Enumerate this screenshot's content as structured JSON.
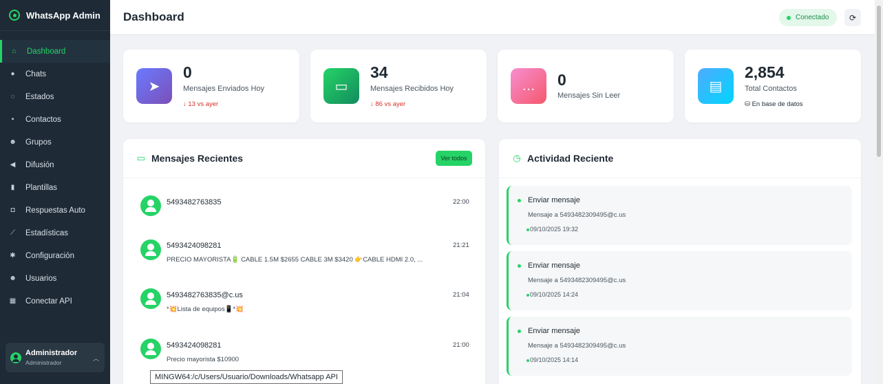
{
  "app": {
    "title": "WhatsApp Admin"
  },
  "sidebar": {
    "items": [
      {
        "label": "Dashboard",
        "icon": "home-icon",
        "glyph": "⌂"
      },
      {
        "label": "Chats",
        "icon": "comments-icon",
        "glyph": "●"
      },
      {
        "label": "Estados",
        "icon": "circle-notch-icon",
        "glyph": "◌"
      },
      {
        "label": "Contactos",
        "icon": "address-book-icon",
        "glyph": "▪"
      },
      {
        "label": "Grupos",
        "icon": "users-icon",
        "glyph": "☻"
      },
      {
        "label": "Difusión",
        "icon": "bullhorn-icon",
        "glyph": "◀"
      },
      {
        "label": "Plantillas",
        "icon": "file-icon",
        "glyph": "▮"
      },
      {
        "label": "Respuestas Auto",
        "icon": "robot-icon",
        "glyph": "◘"
      },
      {
        "label": "Estadísticas",
        "icon": "chart-line-icon",
        "glyph": "⟋"
      },
      {
        "label": "Configuración",
        "icon": "gear-icon",
        "glyph": "✱"
      },
      {
        "label": "Usuarios",
        "icon": "user-group-icon",
        "glyph": "☻"
      },
      {
        "label": "Conectar API",
        "icon": "qrcode-icon",
        "glyph": "▦"
      }
    ],
    "user": {
      "name": "Administrador",
      "role": "Administrador"
    }
  },
  "header": {
    "title": "Dashboard",
    "status": "Conectado",
    "refresh_icon": "sync-icon"
  },
  "stats": [
    {
      "value": "0",
      "label": "Mensajes Enviados Hoy",
      "sub": "↓ 13 vs ayer",
      "icon": "paper-plane-icon",
      "glyph": "➤",
      "gradient": [
        "#6a7bff",
        "#7b4fb8"
      ]
    },
    {
      "value": "34",
      "label": "Mensajes Recibidos Hoy",
      "sub": "↓ 86 vs ayer",
      "icon": "inbox-icon",
      "glyph": "▭",
      "gradient": [
        "#25d366",
        "#128c5e"
      ]
    },
    {
      "value": "0",
      "label": "Mensajes Sin Leer",
      "sub": "",
      "icon": "comment-dots-icon",
      "glyph": "…",
      "gradient": [
        "#f78fd0",
        "#f5576c"
      ]
    },
    {
      "value": "2,854",
      "label": "Total Contactos",
      "sub": "⛁ En base de datos",
      "icon": "address-card-icon",
      "glyph": "▤",
      "gradient": [
        "#4facfe",
        "#00d4ff"
      ]
    }
  ],
  "recent_messages": {
    "title": "Mensajes Recientes",
    "button": "Ver todos",
    "items": [
      {
        "name": "5493482763835",
        "text": "",
        "time": "22:00"
      },
      {
        "name": "5493424098281",
        "text": "PRECIO MAYORISTA🔋 CABLE 1.5M $2655 CABLE 3M $3420 👉CABLE HDMI 2.0, ...",
        "time": "21:21"
      },
      {
        "name": "5493482763835@c.us",
        "text": "*💥Lista de equipos📱*💥",
        "time": "21:04"
      },
      {
        "name": "5493424098281",
        "text": "Precio mayorista $10900",
        "time": "21:00"
      }
    ]
  },
  "recent_activity": {
    "title": "Actividad Reciente",
    "items": [
      {
        "title": "Enviar mensaje",
        "desc": "Mensaje a 5493482309495@c.us",
        "time": "09/10/2025 19:32"
      },
      {
        "title": "Enviar mensaje",
        "desc": "Mensaje a 5493482309495@c.us",
        "time": "09/10/2025 14:24"
      },
      {
        "title": "Enviar mensaje",
        "desc": "Mensaje a 5493482309495@c.us",
        "time": "09/10/2025 14:14"
      }
    ]
  },
  "tooltip": "MINGW64:/c/Users/Usuario/Downloads/Whatsapp API"
}
